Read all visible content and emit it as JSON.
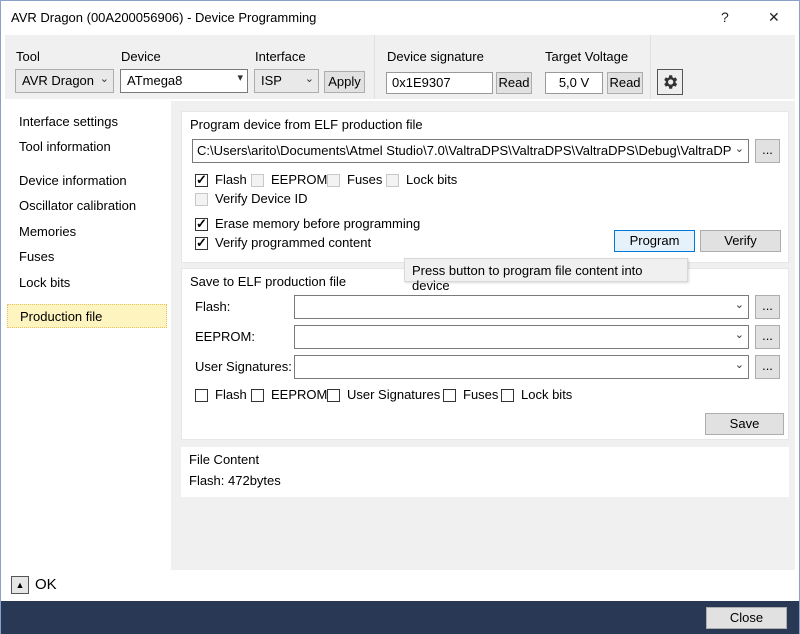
{
  "window": {
    "title": "AVR Dragon (00A200056906) - Device Programming",
    "help": "?",
    "close": "✕"
  },
  "toolbar": {
    "tool_label": "Tool",
    "tool_value": "AVR Dragon",
    "device_label": "Device",
    "device_value": "ATmega8",
    "interface_label": "Interface",
    "interface_value": "ISP",
    "apply": "Apply",
    "signature_label": "Device signature",
    "signature_value": "0x1E9307",
    "signature_read": "Read",
    "voltage_label": "Target Voltage",
    "voltage_value": "5,0 V",
    "voltage_read": "Read"
  },
  "sidebar": {
    "items": [
      {
        "label": "Interface settings"
      },
      {
        "label": "Tool information"
      },
      {
        "label": "Device information"
      },
      {
        "label": "Oscillator calibration"
      },
      {
        "label": "Memories"
      },
      {
        "label": "Fuses"
      },
      {
        "label": "Lock bits"
      },
      {
        "label": "Production file"
      }
    ]
  },
  "program": {
    "title": "Program device from ELF production file",
    "path": "C:\\Users\\arito\\Documents\\Atmel Studio\\7.0\\ValtraDPS\\ValtraDPS\\ValtraDPS\\Debug\\ValtraDPS.",
    "browse": "...",
    "flash": "Flash",
    "eeprom": "EEPROM",
    "fuses": "Fuses",
    "lockbits": "Lock bits",
    "verify_id": "Verify Device ID",
    "erase": "Erase memory before programming",
    "verify_content": "Verify programmed content",
    "program_btn": "Program",
    "verify_btn": "Verify",
    "tooltip": "Press button to program file content into device"
  },
  "save": {
    "title": "Save to ELF production file",
    "flash_label": "Flash:",
    "eeprom_label": "EEPROM:",
    "usersig_label": "User Signatures:",
    "browse": "...",
    "cb_flash": "Flash",
    "cb_eeprom": "EEPROM",
    "cb_usersig": "User Signatures",
    "cb_fuses": "Fuses",
    "cb_lockbits": "Lock bits",
    "save_btn": "Save"
  },
  "file_content": {
    "title": "File Content",
    "value": "Flash: 472bytes"
  },
  "footer": {
    "ok": "OK",
    "close": "Close",
    "expander": "▲"
  },
  "colors": {
    "status_bar": "#293955",
    "selected_item": "#fdf4bf",
    "accent": "#0078d7"
  }
}
